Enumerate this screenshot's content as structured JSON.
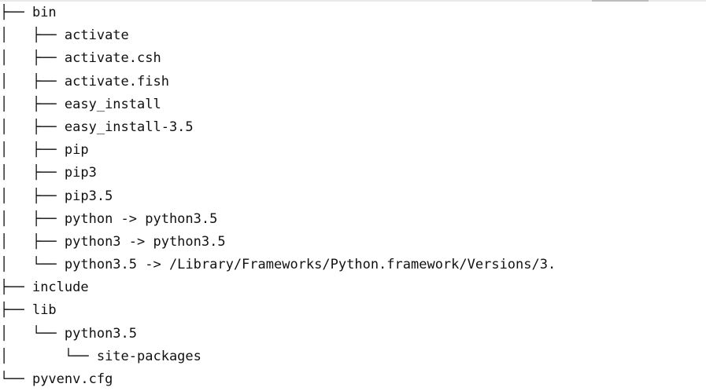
{
  "tree": {
    "lines": [
      {
        "prefix": "├── ",
        "name": "bin"
      },
      {
        "prefix": "│   ├── ",
        "name": "activate"
      },
      {
        "prefix": "│   ├── ",
        "name": "activate.csh"
      },
      {
        "prefix": "│   ├── ",
        "name": "activate.fish"
      },
      {
        "prefix": "│   ├── ",
        "name": "easy_install"
      },
      {
        "prefix": "│   ├── ",
        "name": "easy_install-3.5"
      },
      {
        "prefix": "│   ├── ",
        "name": "pip"
      },
      {
        "prefix": "│   ├── ",
        "name": "pip3"
      },
      {
        "prefix": "│   ├── ",
        "name": "pip3.5"
      },
      {
        "prefix": "│   ├── ",
        "name": "python -> python3.5"
      },
      {
        "prefix": "│   ├── ",
        "name": "python3 -> python3.5"
      },
      {
        "prefix": "│   └── ",
        "name": "python3.5 -> /Library/Frameworks/Python.framework/Versions/3."
      },
      {
        "prefix": "├── ",
        "name": "include"
      },
      {
        "prefix": "├── ",
        "name": "lib"
      },
      {
        "prefix": "│   └── ",
        "name": "python3.5"
      },
      {
        "prefix": "│       └── ",
        "name": "site-packages"
      },
      {
        "prefix": "└── ",
        "name": "pyvenv.cfg"
      }
    ]
  }
}
